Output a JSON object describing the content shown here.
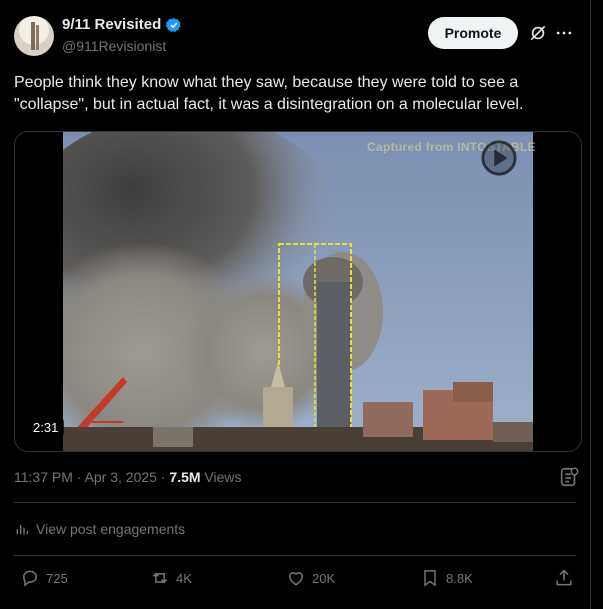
{
  "author": {
    "display_name": "9/11 Revisited",
    "handle": "@911Revisionist",
    "verified": true,
    "verified_color": "#1d9bf0"
  },
  "header_actions": {
    "promote_label": "Promote",
    "grok_icon": "grok-icon",
    "more_icon": "more-icon"
  },
  "post": {
    "text": "People think they know what they saw, because they were told to see a \"collapse\", but in actual fact, it was a disintegration on a molecular level."
  },
  "media": {
    "type": "video",
    "duration": "2:31",
    "watermark": "Captured from INTOSTABLE",
    "play_icon": "play-icon"
  },
  "meta": {
    "time": "11:37 PM",
    "separator": " · ",
    "date": "Apr 3, 2025",
    "separator2": " · ",
    "views_count": "7.5M",
    "views_label": " Views"
  },
  "engagements": {
    "label": "View post engagements"
  },
  "actions": {
    "replies": "725",
    "reposts": "4K",
    "likes": "20K",
    "bookmarks": "8.8K"
  }
}
